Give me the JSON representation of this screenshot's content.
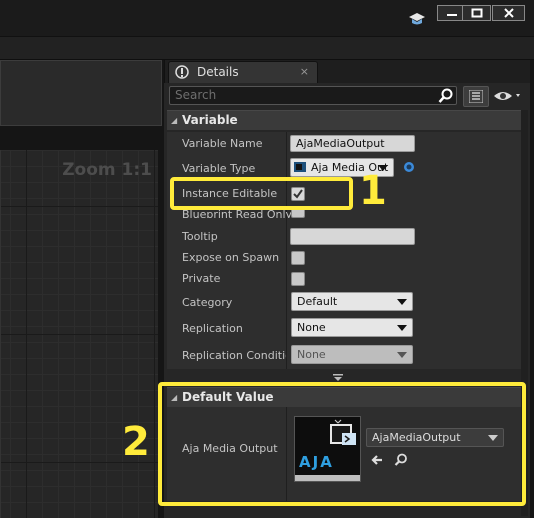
{
  "window": {
    "minimize_label": "—",
    "maximize_label": "☐",
    "close_label": "✕"
  },
  "graph": {
    "zoom_label": "Zoom 1:1"
  },
  "details_panel": {
    "tab_label": "Details",
    "tab_close": "×",
    "search_placeholder": "Search"
  },
  "variable_section": {
    "header": "Variable",
    "name_label": "Variable Name",
    "name_value": "AjaMediaOutput",
    "type_label": "Variable Type",
    "type_value": "Aja Media Out",
    "instance_editable_label": "Instance Editable",
    "blueprint_read_only_label": "Blueprint Read Only",
    "tooltip_label": "Tooltip",
    "expose_on_spawn_label": "Expose on Spawn",
    "private_label": "Private",
    "category_label": "Category",
    "category_value": "Default",
    "replication_label": "Replication",
    "replication_value": "None",
    "replication_condition_label": "Replication Condition",
    "replication_condition_value": "None"
  },
  "default_value_section": {
    "header": "Default Value",
    "property_label": "Aja Media Output",
    "asset_value": "AjaMediaOutput",
    "thumbnail_text": "AJA"
  },
  "annotations": {
    "one": "1",
    "two": "2"
  },
  "colors": {
    "highlight": "#ffeb3b",
    "panel_bg": "#262626",
    "section_header": "#3a3a3a"
  },
  "icons": [
    "graduation-cap-icon",
    "search-icon",
    "list-view-icon",
    "eye-icon",
    "details-icon",
    "variable-type-icon",
    "browse-arrow-icon",
    "magnify-icon"
  ]
}
